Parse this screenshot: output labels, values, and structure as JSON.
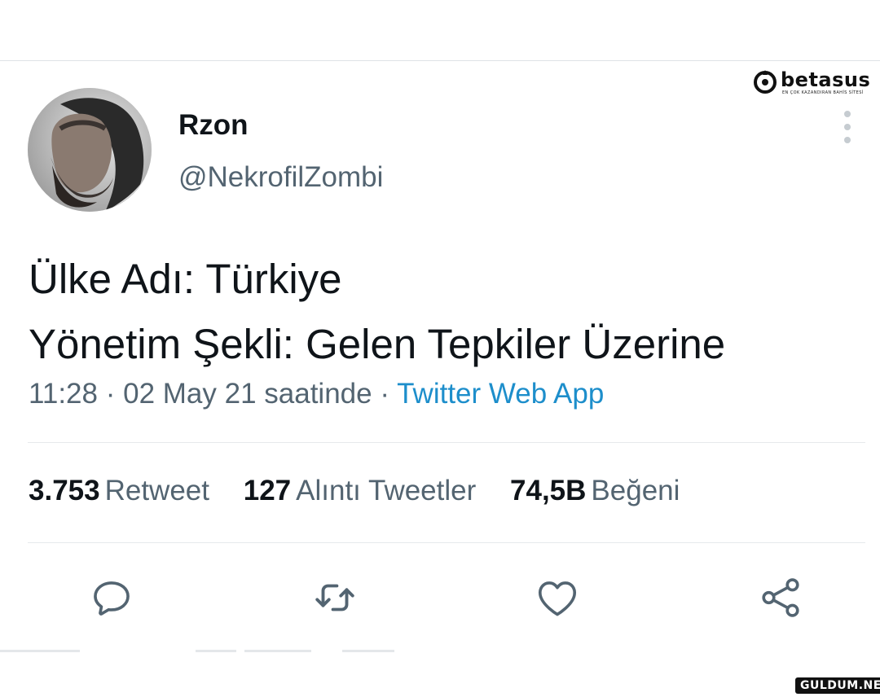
{
  "tweet": {
    "display_name": "Rzon",
    "handle": "@NekrofilZombi",
    "text_lines": [
      "Ülke Adı: Türkiye",
      "Yönetim Şekli: Gelen Tepkiler Üzerine"
    ],
    "time": "11:28",
    "date": "02 May 21 saatinde",
    "separator": "·",
    "source": "Twitter Web App"
  },
  "stats": [
    {
      "count": "3.753",
      "label": "Retweet"
    },
    {
      "count": "127",
      "label": "Alıntı Tweetler"
    },
    {
      "count": "74,5B",
      "label": "Beğeni"
    }
  ],
  "actions": [
    "reply-icon",
    "retweet-icon",
    "like-icon",
    "share-icon"
  ],
  "watermarks": {
    "top_brand": "betasus",
    "top_tagline": "EN ÇOK KAZANDIRAN BAHİS SİTESİ",
    "bottom_brand": "GULDUM.NET"
  },
  "colors": {
    "text_primary": "#0f1419",
    "text_secondary": "#536471",
    "link": "#1d8ecb",
    "icon": "#536471",
    "divider": "#e6e9ec"
  }
}
